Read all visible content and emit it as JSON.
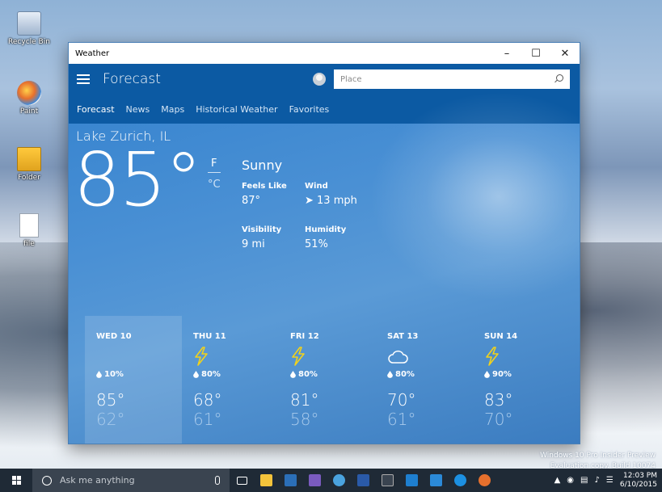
{
  "desktop": {
    "icons": [
      {
        "label": "Recycle Bin"
      },
      {
        "label": "Paint"
      },
      {
        "label": "Folder"
      },
      {
        "label": "file"
      }
    ],
    "watermark_line1": "Windows 10 Pro Insider Preview",
    "watermark_line2": "Evaluation copy. Build 10074"
  },
  "window": {
    "title": "Weather",
    "controls": {
      "minimize": "–",
      "maximize": "☐",
      "close": "✕"
    }
  },
  "header": {
    "heading": "Forecast",
    "search_placeholder": "Place"
  },
  "tabs": [
    "Forecast",
    "News",
    "Maps",
    "Historical Weather",
    "Favorites"
  ],
  "current": {
    "location": "Lake Zurich, IL",
    "temperature": "85°",
    "unit_f": "F",
    "unit_c": "°C",
    "condition": "Sunny",
    "feels_like_label": "Feels Like",
    "feels_like_value": "87°",
    "wind_label": "Wind",
    "wind_value": "➤ 13 mph",
    "visibility_label": "Visibility",
    "visibility_value": "9 mi",
    "humidity_label": "Humidity",
    "humidity_value": "51%"
  },
  "forecast": [
    {
      "day": "WED 10",
      "icon": "none",
      "precip": "10%",
      "high": "85°",
      "low": "62°"
    },
    {
      "day": "THU 11",
      "icon": "bolt-icon",
      "precip": "80%",
      "high": "68°",
      "low": "61°"
    },
    {
      "day": "FRI 12",
      "icon": "bolt-icon",
      "precip": "80%",
      "high": "81°",
      "low": "58°"
    },
    {
      "day": "SAT 13",
      "icon": "cloud-icon",
      "precip": "80%",
      "high": "70°",
      "low": "61°"
    },
    {
      "day": "SUN 14",
      "icon": "bolt-icon",
      "precip": "90%",
      "high": "83°",
      "low": "70°"
    }
  ],
  "taskbar": {
    "search_placeholder": "Ask me anything",
    "time": "12:03 PM",
    "date": "6/10/2015"
  },
  "colors": {
    "header": "#0c5aa3",
    "content": "#3a86d0",
    "bolt": "#f2d21b",
    "taskbar": "#1f2a36"
  }
}
